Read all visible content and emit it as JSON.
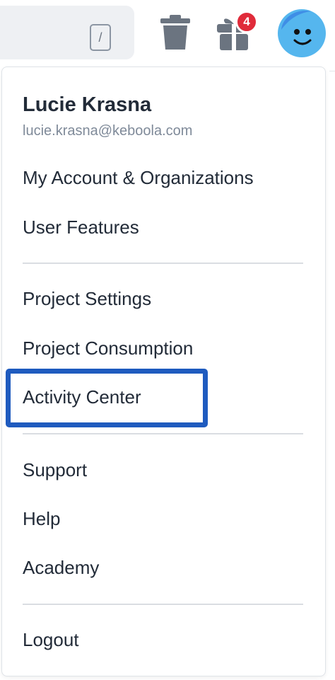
{
  "topbar": {
    "search_shortcut": "/",
    "trash_icon": "trash-icon",
    "gift_icon": "gift-icon",
    "notifications_count": "4",
    "avatar_icon": "avatar-smiley-icon",
    "colors": {
      "icon": "#6b7480",
      "badge": "#e02b3a",
      "avatar": "#55b6ee"
    }
  },
  "user": {
    "name": "Lucie Krasna",
    "email": "lucie.krasna@keboola.com"
  },
  "menu": {
    "account": "My Account & Organizations",
    "user_features": "User Features",
    "project_settings": "Project Settings",
    "project_consumption": "Project Consumption",
    "activity_center": "Activity Center",
    "support": "Support",
    "help": "Help",
    "academy": "Academy",
    "logout": "Logout"
  },
  "highlight_color": "#1f5bbf"
}
